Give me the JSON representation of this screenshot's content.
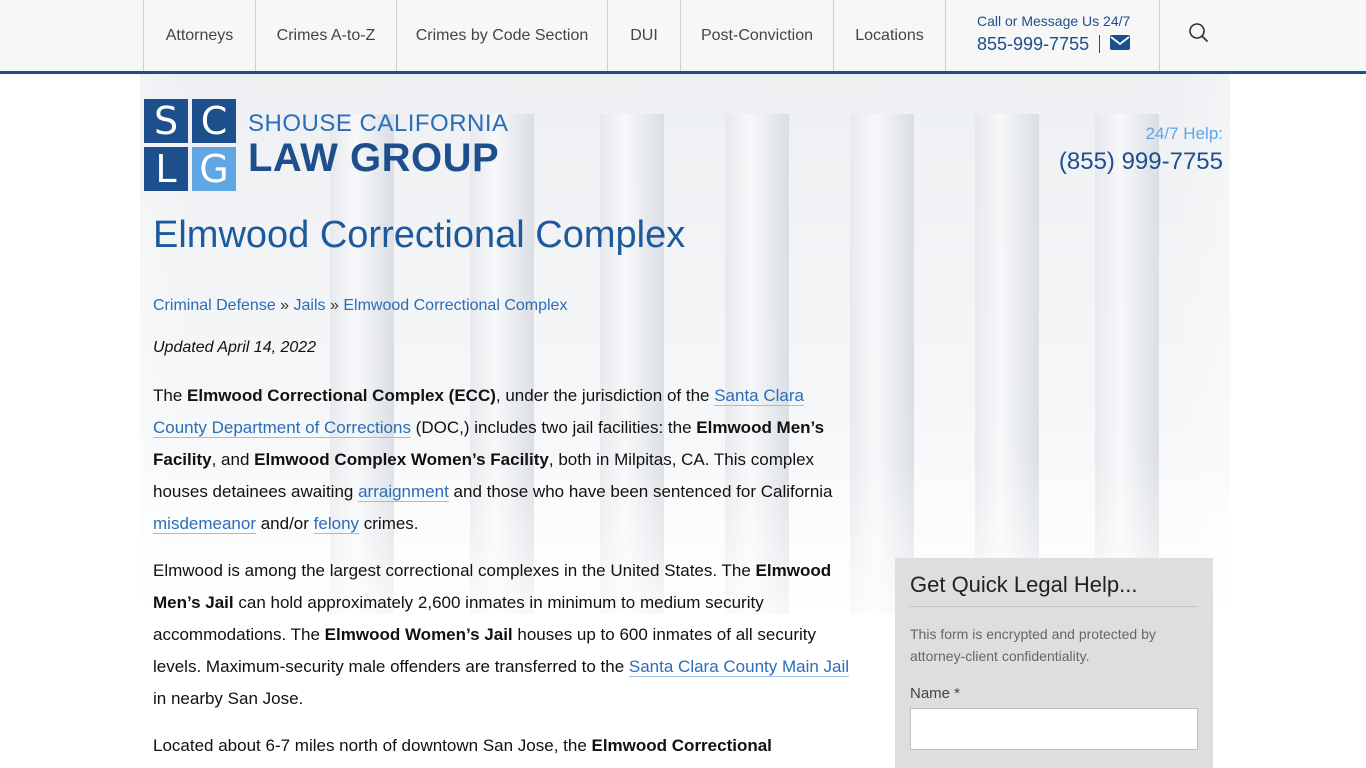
{
  "nav": {
    "items": [
      {
        "label": "Attorneys"
      },
      {
        "label": "Crimes A-to-Z"
      },
      {
        "label": "Crimes by Code Section"
      },
      {
        "label": "DUI"
      },
      {
        "label": "Post-Conviction"
      },
      {
        "label": "Locations"
      }
    ],
    "call_label": "Call or Message Us 24/7",
    "call_phone": "855-999-7755",
    "email_icon": "envelope-icon",
    "search_icon": "search-icon"
  },
  "logo": {
    "letters": [
      "S",
      "C",
      "L",
      "G"
    ],
    "line1": "SHOUSE CALIFORNIA",
    "line2": "LAW GROUP"
  },
  "help": {
    "label": "24/7 Help:",
    "phone": "(855) 999-7755"
  },
  "page": {
    "title": "Elmwood Correctional Complex",
    "breadcrumb": [
      "Criminal Defense",
      "Jails",
      "Elmwood Correctional Complex"
    ],
    "breadcrumb_sep": "»",
    "updated": "Updated April 14, 2022"
  },
  "content": {
    "p1": [
      {
        "t": "The "
      },
      {
        "b": "Elmwood Correctional Complex (ECC)"
      },
      {
        "t": ", under the jurisdiction of the "
      },
      {
        "a": "Santa Clara County Department of Corrections"
      },
      {
        "t": " (DOC,) includes two jail facilities: the "
      },
      {
        "b": "Elmwood Men’s Facility"
      },
      {
        "t": ", and "
      },
      {
        "b": "Elmwood Complex Women’s Facility"
      },
      {
        "t": ", both in Milpitas, CA. This complex houses detainees awaiting "
      },
      {
        "a": "arraignment"
      },
      {
        "t": " and those who have been sentenced for California "
      },
      {
        "a": "misdemeanor"
      },
      {
        "t": " and/or "
      },
      {
        "a": "felony"
      },
      {
        "t": " crimes."
      }
    ],
    "p2": [
      {
        "t": "Elmwood is among the largest correctional complexes in the United States. The "
      },
      {
        "b": "Elmwood Men’s Jail"
      },
      {
        "t": " can hold approximately 2,600 inmates in minimum to medium security accommodations. The "
      },
      {
        "b": "Elmwood Women’s Jail"
      },
      {
        "t": " houses up to 600 inmates of all security levels. Maximum-security male offenders are transferred to the "
      },
      {
        "a": "Santa Clara County Main Jail"
      },
      {
        "t": " in nearby San Jose."
      }
    ],
    "p3": [
      {
        "t": "Located about 6-7 miles north of downtown San Jose, the "
      },
      {
        "b": "Elmwood Correctional"
      }
    ]
  },
  "form": {
    "title": "Get Quick Legal Help...",
    "note": "This form is encrypted and protected by attorney-client confidentiality.",
    "name_label": "Name *",
    "name_value": ""
  },
  "colors": {
    "brand": "#1d4f8c",
    "accent": "#5fa6e3",
    "link": "#2a6db8"
  }
}
